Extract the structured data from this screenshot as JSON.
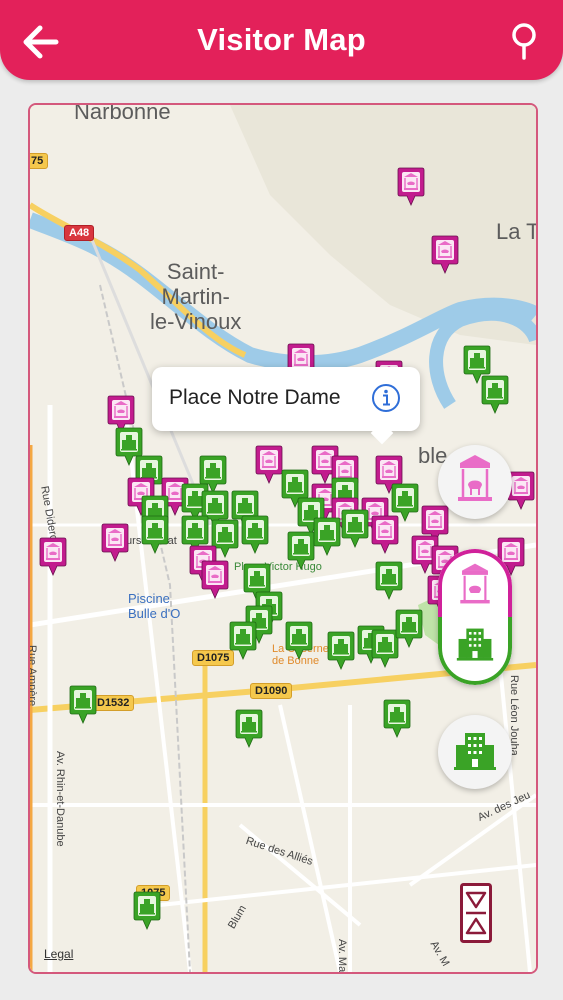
{
  "header": {
    "title": "Visitor Map"
  },
  "icons": {
    "back": "back-arrow-icon",
    "location": "location-pin-icon",
    "info": "info-icon",
    "attraction": "carousel-icon",
    "hotel": "hotel-building-icon",
    "expand": "expand-collapse-icon"
  },
  "colors": {
    "brand": "#e3215a",
    "attraction_marker": "#c21c8e",
    "hotel_marker": "#3aa326"
  },
  "map": {
    "places": {
      "narbonne": "Narbonne",
      "saint_martin": "Saint-\nMartin-\nle-Vinoux",
      "la_t": "La T",
      "grenoble_partial": "ble"
    },
    "roads": {
      "a48": "A48",
      "r75": "75",
      "d1075": "D1075",
      "d1090": "D1090",
      "d1532": "D1532",
      "r075": "1075"
    },
    "streets": {
      "cours_berriat": "Cours Berriat",
      "place_victor_hugo": "Place Victor Hugo",
      "piscine": "Piscine\nBulle d'O",
      "caserne": "La Caserne\nde Bonne",
      "rue_ampere": "Rue Ampère",
      "rue_diderot": "Rue Didero",
      "rhin_danube": "Av. Rhin-et-Danube",
      "rue_allies": "Rue des Alliés",
      "blum": "Blum",
      "av_ma": "Av. Ma",
      "av_jeu": "Av. des Jeu",
      "rue_leon": "Rue Léon Jouha",
      "av_m": "Av. M"
    },
    "legal": "Legal"
  },
  "callout": {
    "title": "Place Notre Dame"
  }
}
